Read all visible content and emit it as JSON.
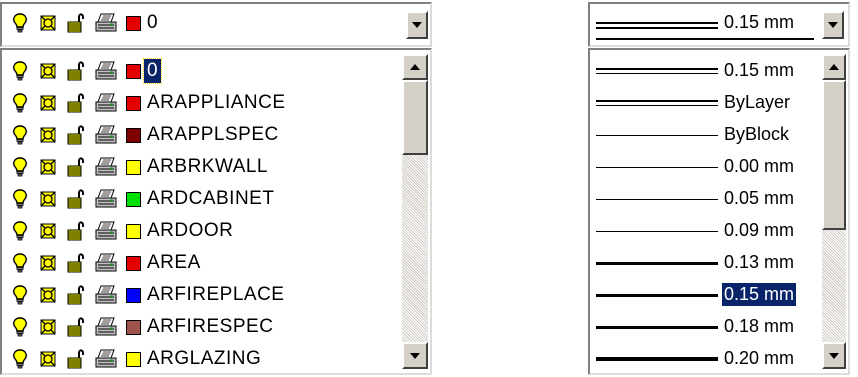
{
  "layer_combo": {
    "current_name": "0",
    "current_color": "#e30000"
  },
  "layer_list": {
    "selected_index": 0,
    "items": [
      {
        "name": "0",
        "color": "#e30000"
      },
      {
        "name": "ARAPPLIANCE",
        "color": "#e30000"
      },
      {
        "name": "ARAPPLSPEC",
        "color": "#7f0000"
      },
      {
        "name": "ARBRKWALL",
        "color": "#ffff00"
      },
      {
        "name": "ARDCABINET",
        "color": "#00e000"
      },
      {
        "name": "ARDOOR",
        "color": "#ffff00"
      },
      {
        "name": "AREA",
        "color": "#e30000"
      },
      {
        "name": "ARFIREPLACE",
        "color": "#0000ff"
      },
      {
        "name": "ARFIRESPEC",
        "color": "#a0524d"
      },
      {
        "name": "ARGLAZING",
        "color": "#ffff00"
      }
    ],
    "icon_names": [
      "lightbulb-on-icon",
      "sun-thawed-icon",
      "unlocked-padlock-icon",
      "plotter-icon"
    ]
  },
  "lineweight_combo": {
    "current_label": "0.15 mm"
  },
  "lineweight_list": {
    "selected_index": 7,
    "items": [
      {
        "label": "0.15 mm",
        "style": "double"
      },
      {
        "label": "ByLayer",
        "style": "double"
      },
      {
        "label": "ByBlock",
        "style": "thin"
      },
      {
        "label": "0.00 mm",
        "style": "thin"
      },
      {
        "label": "0.05 mm",
        "style": "thin"
      },
      {
        "label": "0.09 mm",
        "style": "thin"
      },
      {
        "label": "0.13 mm",
        "style": "medium"
      },
      {
        "label": "0.15 mm",
        "style": "medium"
      },
      {
        "label": "0.18 mm",
        "style": "medium"
      },
      {
        "label": "0.20 mm",
        "style": "heavy"
      }
    ]
  },
  "colors": {
    "selection": "#0a246a",
    "button_face": "#d4d0c8"
  }
}
